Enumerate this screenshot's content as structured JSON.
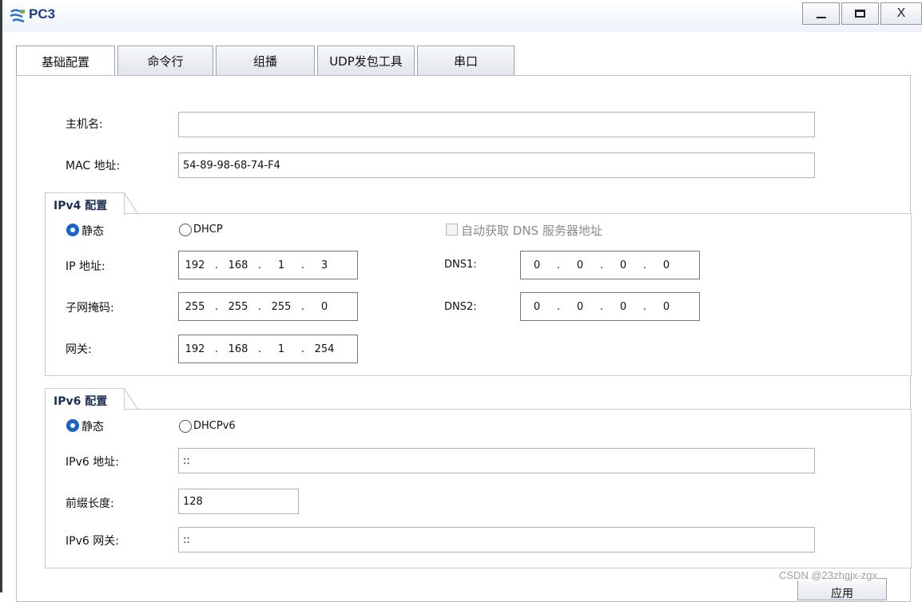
{
  "window": {
    "title": "PC3",
    "minimize_icon": "minimize-icon",
    "maximize_icon": "maximize-icon",
    "close_label": "X"
  },
  "tabs": [
    {
      "label": "基础配置",
      "active": true
    },
    {
      "label": "命令行"
    },
    {
      "label": "组播"
    },
    {
      "label": "UDP发包工具"
    },
    {
      "label": "串口"
    }
  ],
  "basic": {
    "hostname_label": "主机名:",
    "hostname_value": "",
    "mac_label": "MAC 地址:",
    "mac_value": "54-89-98-68-74-F4"
  },
  "ipv4": {
    "title": "IPv4 配置",
    "static_label": "静态",
    "dhcp_label": "DHCP",
    "mode": "static",
    "auto_dns_label": "自动获取 DNS 服务器地址",
    "auto_dns_checked": false,
    "ip_label": "IP 地址:",
    "ip": [
      "192",
      "168",
      "1",
      "3"
    ],
    "mask_label": "子网掩码:",
    "mask": [
      "255",
      "255",
      "255",
      "0"
    ],
    "gateway_label": "网关:",
    "gateway": [
      "192",
      "168",
      "1",
      "254"
    ],
    "dns1_label": "DNS1:",
    "dns1": [
      "0",
      "0",
      "0",
      "0"
    ],
    "dns2_label": "DNS2:",
    "dns2": [
      "0",
      "0",
      "0",
      "0"
    ]
  },
  "ipv6": {
    "title": "IPv6 配置",
    "static_label": "静态",
    "dhcp_label": "DHCPv6",
    "mode": "static",
    "address_label": "IPv6 地址:",
    "address_value": "::",
    "prefix_label": "前缀长度:",
    "prefix_value": "128",
    "gateway_label": "IPv6 网关:",
    "gateway_value": "::"
  },
  "apply_label": "应用",
  "watermark": "CSDN @23zhgjx-zgx",
  "colors": {
    "title_text": "#1b3c8c",
    "radio_selected": "#1a64c8",
    "group_title": "#1d2e55"
  }
}
